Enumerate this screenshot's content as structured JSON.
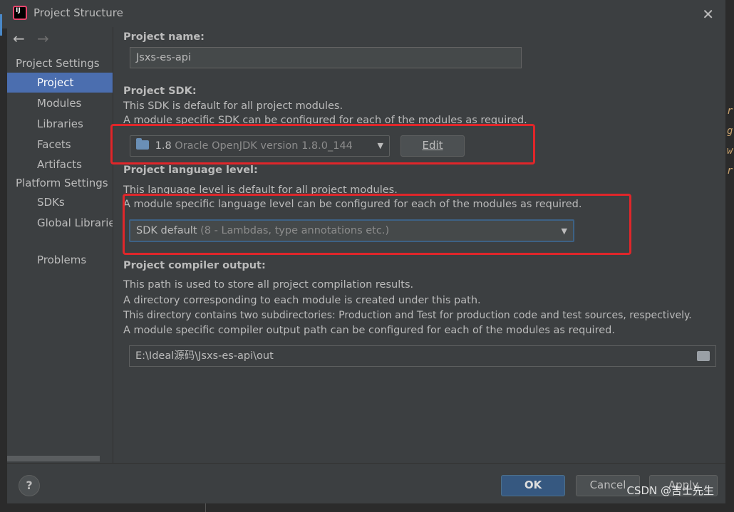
{
  "window": {
    "title": "Project Structure"
  },
  "sidebar": {
    "groups": [
      {
        "header": "Project Settings",
        "items": [
          "Project",
          "Modules",
          "Libraries",
          "Facets",
          "Artifacts"
        ]
      },
      {
        "header": "Platform Settings",
        "items": [
          "SDKs",
          "Global Libraries"
        ]
      }
    ],
    "extra_item": "Problems",
    "selected": "Project"
  },
  "project_name": {
    "label": "Project name:",
    "value": "Jsxs-es-api"
  },
  "project_sdk": {
    "label": "Project SDK:",
    "desc1": "This SDK is default for all project modules.",
    "desc2": "A module specific SDK can be configured for each of the modules as required.",
    "selected_version": "1.8",
    "selected_detail": "Oracle OpenJDK version 1.8.0_144",
    "edit_label": "Edit"
  },
  "language_level": {
    "label": "Project language level:",
    "desc1": "This language level is default for all project modules.",
    "desc2": "A module specific language level can be configured for each of the modules as required.",
    "selected": "SDK default",
    "selected_detail": "(8 - Lambdas, type annotations etc.)"
  },
  "compiler_output": {
    "label": "Project compiler output:",
    "desc1": "This path is used to store all project compilation results.",
    "desc2": "A directory corresponding to each module is created under this path.",
    "desc3": "This directory contains two subdirectories: Production and Test for production code and test sources, respectively.",
    "desc4": "A module specific compiler output path can be configured for each of the modules as required.",
    "path": "E:\\Ideal源码\\Jsxs-es-api\\out"
  },
  "footer": {
    "help": "?",
    "ok": "OK",
    "cancel": "Cancel",
    "apply": "Apply"
  },
  "watermark": "CSDN @吉士先生",
  "colors": {
    "selection": "#4b6eaf",
    "highlight_box": "#e0262a",
    "primary_button": "#365880"
  }
}
